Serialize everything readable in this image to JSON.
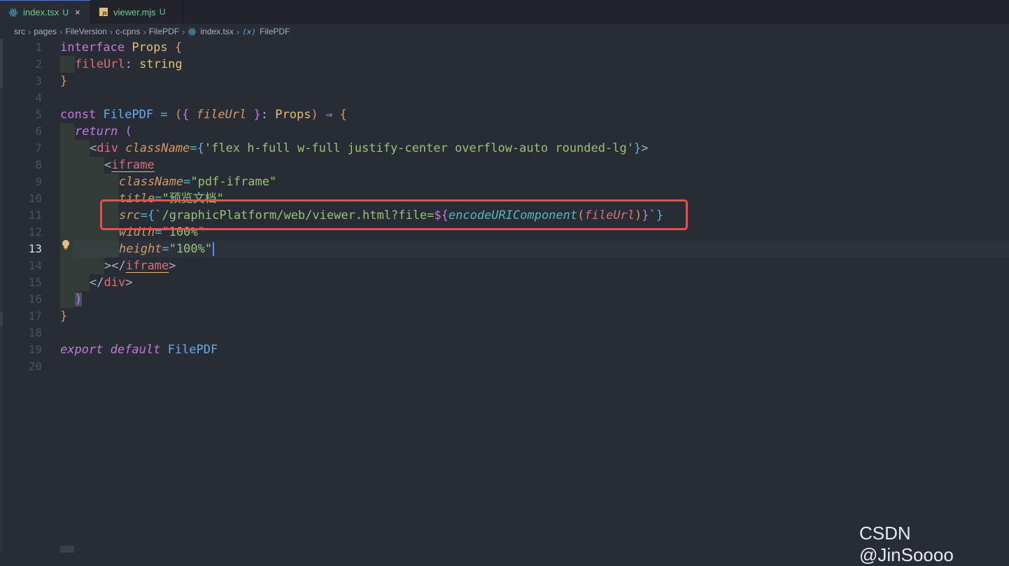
{
  "tabs": [
    {
      "name": "index.tsx",
      "status": "U",
      "close": "×",
      "active": true,
      "icon": "react-icon"
    },
    {
      "name": "viewer.mjs",
      "status": "U",
      "active": false,
      "icon": "js-file-icon",
      "icon_text": "JS"
    }
  ],
  "breadcrumb": [
    "src",
    "pages",
    "FileVersion",
    "c-cpns",
    "FilePDF",
    "index.tsx",
    "FilePDF"
  ],
  "breadcrumb_var_icon": "(x)",
  "line_numbers": [
    "1",
    "2",
    "3",
    "4",
    "5",
    "6",
    "7",
    "8",
    "9",
    "10",
    "11",
    "12",
    "13",
    "14",
    "15",
    "16",
    "17",
    "18",
    "19",
    "20"
  ],
  "current_line": 13,
  "code": {
    "l1": {
      "kw": "interface",
      "name": "Props",
      "brace": "{"
    },
    "l2": {
      "prop": "fileUrl",
      "colon": ":",
      "type": "string"
    },
    "l3": {
      "brace": "}"
    },
    "l5": {
      "kw": "const",
      "name": "FilePDF",
      "eq": "=",
      "p1": "(",
      "b1": "{",
      "arg": "fileUrl",
      "b2": "}",
      "colon": ":",
      "type": "Props",
      "p2": ")",
      "arrow": "⇒",
      "b3": "{"
    },
    "l6": {
      "kw": "return",
      "paren": "("
    },
    "l7": {
      "lt": "<",
      "tag": "div",
      "attr": "className",
      "eq": "=",
      "b1": "{",
      "str": "'flex h-full w-full justify-center overflow-auto rounded-lg'",
      "b2": "}",
      "gt": ">"
    },
    "l8": {
      "lt": "<",
      "tag": "iframe"
    },
    "l9": {
      "attr": "className",
      "eq": "=",
      "str": "\"pdf-iframe\""
    },
    "l10": {
      "attr": "title",
      "eq": "=",
      "str": "\"预览文档\""
    },
    "l11": {
      "attr": "src",
      "eq": "=",
      "b1": "{",
      "tick1": "`",
      "str": "/graphicPlatform/web/viewer.html?file=",
      "interp": "${",
      "fn": "encodeURIComponent",
      "p1": "(",
      "arg": "fileUrl",
      "p2": ")",
      "close": "}",
      "tick2": "`",
      "b2": "}"
    },
    "l12": {
      "attr": "width",
      "eq": "=",
      "str": "\"100%\""
    },
    "l13": {
      "attr": "height",
      "eq": "=",
      "str": "\"100%\""
    },
    "l14": {
      "gt": ">",
      "lt": "</",
      "tag": "iframe",
      "gt2": ">"
    },
    "l15": {
      "lt": "</",
      "tag": "div",
      "gt": ">"
    },
    "l16": {
      "paren": ")"
    },
    "l17": {
      "brace": "}"
    },
    "l19": {
      "kw1": "export",
      "kw2": "default",
      "name": "FilePDF"
    }
  },
  "watermark": "CSDN @JinSoooo",
  "colors": {
    "highlight": "#e8504a",
    "background": "#282c34"
  }
}
